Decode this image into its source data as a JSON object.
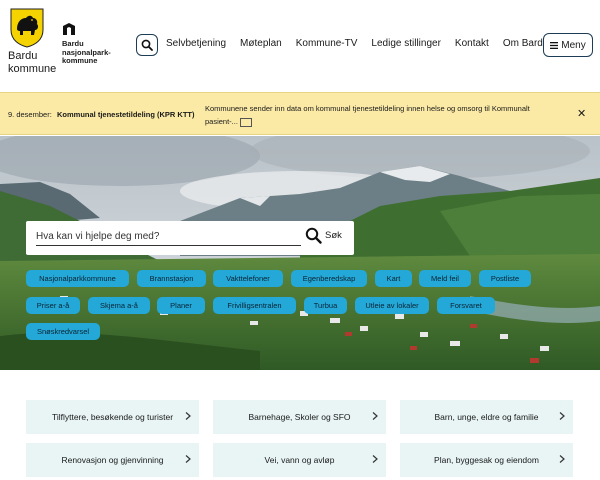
{
  "header": {
    "logo_line1": "Bardu",
    "logo_line2": "kommune",
    "np_line1": "Bardu",
    "np_line2": "nasjonalpark-",
    "np_line3": "kommune",
    "nav": [
      {
        "label": "Selvbetjening"
      },
      {
        "label": "Møteplan"
      },
      {
        "label": "Kommune-TV"
      },
      {
        "label": "Ledige stillinger"
      },
      {
        "label": "Kontakt"
      },
      {
        "label": "Om Bardu"
      }
    ],
    "menu_label": "Meny"
  },
  "alert": {
    "date": "9. desember:",
    "title": "Kommunal tjenestetildeling (KPR KTT)",
    "body_line1": "Kommunene sender inn data om kommunal tjenestetildeling innen helse og omsorg til Kommunalt",
    "body_line2": "pasient-..."
  },
  "search": {
    "placeholder": "Hva kan vi hjelpe deg med?",
    "button_label": "Søk"
  },
  "quick_links": [
    {
      "label": "Nasjonalparkkommune"
    },
    {
      "label": "Brannstasjon"
    },
    {
      "label": "Vakttelefoner"
    },
    {
      "label": "Egenberedskap"
    },
    {
      "label": "Kart"
    },
    {
      "label": "Meld feil"
    },
    {
      "label": "Postliste"
    },
    {
      "label": "Priser a-å"
    },
    {
      "label": "Skjema a-å"
    },
    {
      "label": "Planer"
    },
    {
      "label": "Frivilligsentralen"
    },
    {
      "label": "Turbua"
    },
    {
      "label": "Utleie av lokaler"
    },
    {
      "label": "Forsvaret"
    },
    {
      "label": "Snøskredvarsel"
    }
  ],
  "categories": [
    {
      "label": "Tilflyttere, besøkende og turister"
    },
    {
      "label": "Barnehage, Skoler og SFO"
    },
    {
      "label": "Barn, unge, eldre og familie"
    },
    {
      "label": "Renovasjon og gjenvinning"
    },
    {
      "label": "Vei, vann og avløp"
    },
    {
      "label": "Plan, byggesak og eiendom"
    }
  ],
  "colors": {
    "crest_yellow": "#f5d300",
    "alert_bg": "#fbeaa6",
    "chip_blue": "#23a8d8",
    "card_bg": "#e9f5f5",
    "dark_blue": "#1d3c55"
  }
}
